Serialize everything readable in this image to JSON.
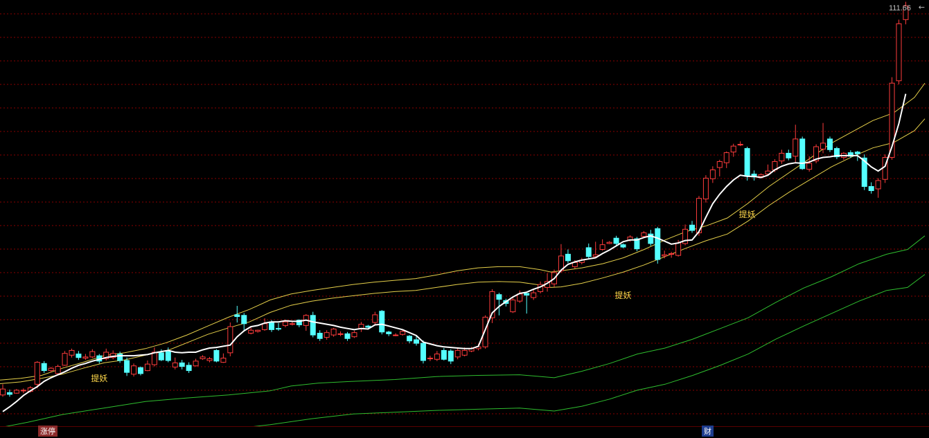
{
  "header": {
    "max_price": "111.66",
    "max_arrow": "←"
  },
  "signals": [
    {
      "label": "提妖"
    },
    {
      "label": "提妖"
    },
    {
      "label": "提妖"
    }
  ],
  "footer": {
    "tag1": "涨停",
    "tag2": "财"
  },
  "colors": {
    "background": "#000000",
    "grid": "#8b0000",
    "up": "#ff3c3c",
    "down": "#54ffff",
    "ma": "#ffffff",
    "band": "#e6d04a",
    "green_band": "#2fbf2f",
    "signal": "#ffd84a"
  },
  "chart_data": {
    "type": "candlestick",
    "ylim": [
      40,
      112
    ],
    "grid": true,
    "max_label": 111.66,
    "candles": [
      [
        45.5,
        46.5,
        45.2,
        47.3
      ],
      [
        45.9,
        45.6,
        45.2,
        46.4
      ],
      [
        45.8,
        46.3,
        45.7,
        46.5
      ],
      [
        46.2,
        46.3,
        45.8,
        46.6
      ],
      [
        46.1,
        46.7,
        45.9,
        47.0
      ],
      [
        47.3,
        51.0,
        46.6,
        51.2
      ],
      [
        50.8,
        49.6,
        49.2,
        51.2
      ],
      [
        49.6,
        50.0,
        49.3,
        50.2
      ],
      [
        49.1,
        50.3,
        48.9,
        50.6
      ],
      [
        50.5,
        52.5,
        50.4,
        52.9
      ],
      [
        52.2,
        53.0,
        51.8,
        53.3
      ],
      [
        52.4,
        51.8,
        51.4,
        52.9
      ],
      [
        51.7,
        51.9,
        51.4,
        52.4
      ],
      [
        51.9,
        52.8,
        51.7,
        53.2
      ],
      [
        52.1,
        51.2,
        50.8,
        52.4
      ],
      [
        51.6,
        52.7,
        51.3,
        53.3
      ],
      [
        51.8,
        52.5,
        51.5,
        53.0
      ],
      [
        52.4,
        51.3,
        50.9,
        52.8
      ],
      [
        51.3,
        49.3,
        48.7,
        51.8
      ],
      [
        49.0,
        50.4,
        48.6,
        50.8
      ],
      [
        50.1,
        49.1,
        48.8,
        50.3
      ],
      [
        49.6,
        50.7,
        49.5,
        51.3
      ],
      [
        50.6,
        52.7,
        50.3,
        53.5
      ],
      [
        52.6,
        51.4,
        51.2,
        53.2
      ],
      [
        52.8,
        51.3,
        51.0,
        53.5
      ],
      [
        50.2,
        50.9,
        49.8,
        51.8
      ],
      [
        50.9,
        50.3,
        49.8,
        51.4
      ],
      [
        50.5,
        49.6,
        49.2,
        51.0
      ],
      [
        50.4,
        51.2,
        50.3,
        51.6
      ],
      [
        51.6,
        51.9,
        51.4,
        52.2
      ],
      [
        51.3,
        51.6,
        51.0,
        51.9
      ],
      [
        53.0,
        51.2,
        51.0,
        53.2
      ],
      [
        51.0,
        51.7,
        50.9,
        52.5
      ],
      [
        52.6,
        57.0,
        52.0,
        57.7
      ],
      [
        59.0,
        58.7,
        57.7,
        60.5
      ],
      [
        58.9,
        57.5,
        56.4,
        59.3
      ],
      [
        55.9,
        56.4,
        55.7,
        57.0
      ],
      [
        56.2,
        56.4,
        56.0,
        56.5
      ],
      [
        56.5,
        57.5,
        56.3,
        58.4
      ],
      [
        57.8,
        56.5,
        56.1,
        58.1
      ],
      [
        56.7,
        56.6,
        56.3,
        57.6
      ],
      [
        57.2,
        57.8,
        56.9,
        58.1
      ],
      [
        57.5,
        57.5,
        57.2,
        58.0
      ],
      [
        58.1,
        57.3,
        56.9,
        58.2
      ],
      [
        57.2,
        58.9,
        56.3,
        59.1
      ],
      [
        58.9,
        55.6,
        55.2,
        59.5
      ],
      [
        55.9,
        55.0,
        54.6,
        56.4
      ],
      [
        55.2,
        56.0,
        54.8,
        56.4
      ],
      [
        55.6,
        56.6,
        55.3,
        56.8
      ],
      [
        55.7,
        55.8,
        55.4,
        56.2
      ],
      [
        55.8,
        55.0,
        54.6,
        56.1
      ],
      [
        55.3,
        56.0,
        55.1,
        56.3
      ],
      [
        56.6,
        57.4,
        56.1,
        57.8
      ],
      [
        57.1,
        56.9,
        56.7,
        57.3
      ],
      [
        57.7,
        59.0,
        57.3,
        59.5
      ],
      [
        59.6,
        56.1,
        55.7,
        59.8
      ],
      [
        56.1,
        55.8,
        55.4,
        56.3
      ],
      [
        55.6,
        55.6,
        55.4,
        55.9
      ],
      [
        55.7,
        56.2,
        55.5,
        56.6
      ],
      [
        55.4,
        54.6,
        54.2,
        55.6
      ],
      [
        54.8,
        54.2,
        53.8,
        55.6
      ],
      [
        54.2,
        51.3,
        50.8,
        54.7
      ],
      [
        51.7,
        51.7,
        51.2,
        52.1
      ],
      [
        51.5,
        52.4,
        51.2,
        52.9
      ],
      [
        53.0,
        51.5,
        51.3,
        53.4
      ],
      [
        52.9,
        51.2,
        50.7,
        53.2
      ],
      [
        51.9,
        53.0,
        51.5,
        53.3
      ],
      [
        52.2,
        53.0,
        52.0,
        53.5
      ],
      [
        52.9,
        53.3,
        52.7,
        53.6
      ],
      [
        53.3,
        53.6,
        53.0,
        54.1
      ],
      [
        53.6,
        58.6,
        53.3,
        58.9
      ],
      [
        58.5,
        62.9,
        57.6,
        63.3
      ],
      [
        62.4,
        61.6,
        58.9,
        62.7
      ],
      [
        61.4,
        60.9,
        60.4,
        61.7
      ],
      [
        59.5,
        61.5,
        59.3,
        62.0
      ],
      [
        61.3,
        62.5,
        61.0,
        63.1
      ],
      [
        62.6,
        62.3,
        59.2,
        62.6
      ],
      [
        61.9,
        62.7,
        61.5,
        63.2
      ],
      [
        62.9,
        64.1,
        62.6,
        64.6
      ],
      [
        63.6,
        64.6,
        62.9,
        66.0
      ],
      [
        64.2,
        66.1,
        63.7,
        66.6
      ],
      [
        66.4,
        68.9,
        66.1,
        70.9
      ],
      [
        69.2,
        68.1,
        67.7,
        70.0
      ],
      [
        67.1,
        67.8,
        66.8,
        68.2
      ],
      [
        67.8,
        68.2,
        67.5,
        68.6
      ],
      [
        70.3,
        68.8,
        68.5,
        71.0
      ],
      [
        68.8,
        69.1,
        68.6,
        71.3
      ],
      [
        70.0,
        70.8,
        69.8,
        71.7
      ],
      [
        71.0,
        71.2,
        70.9,
        71.4
      ],
      [
        71.9,
        71.0,
        70.6,
        72.3
      ],
      [
        70.8,
        70.4,
        70.2,
        71.0
      ],
      [
        71.6,
        72.1,
        71.3,
        72.4
      ],
      [
        71.8,
        70.1,
        69.7,
        72.1
      ],
      [
        72.2,
        72.8,
        71.9,
        73.1
      ],
      [
        72.6,
        71.0,
        70.6,
        73.3
      ],
      [
        73.5,
        68.3,
        67.6,
        73.8
      ],
      [
        68.9,
        69.1,
        68.5,
        69.8
      ],
      [
        69.2,
        69.3,
        68.6,
        69.6
      ],
      [
        69.0,
        71.1,
        68.8,
        71.6
      ],
      [
        71.0,
        73.4,
        70.7,
        74.2
      ],
      [
        74.1,
        73.2,
        72.8,
        74.8
      ],
      [
        72.8,
        78.6,
        72.3,
        79.0
      ],
      [
        78.5,
        82.0,
        77.9,
        82.5
      ],
      [
        81.9,
        83.4,
        81.2,
        84.0
      ],
      [
        83.8,
        84.8,
        82.3,
        85.1
      ],
      [
        84.6,
        86.3,
        83.7,
        86.5
      ],
      [
        86.4,
        87.4,
        85.6,
        87.8
      ],
      [
        87.7,
        87.7,
        87.4,
        88.2
      ],
      [
        87.0,
        82.3,
        81.6,
        87.3
      ],
      [
        82.7,
        82.2,
        81.6,
        83.3
      ],
      [
        82.3,
        82.6,
        82.0,
        82.8
      ],
      [
        82.7,
        83.2,
        82.6,
        84.3
      ],
      [
        83.4,
        84.8,
        83.0,
        85.2
      ],
      [
        84.9,
        86.2,
        84.4,
        86.8
      ],
      [
        86.2,
        85.4,
        85.0,
        86.8
      ],
      [
        85.7,
        88.6,
        84.7,
        91.0
      ],
      [
        88.6,
        83.6,
        83.4,
        89.0
      ],
      [
        83.5,
        84.5,
        83.1,
        85.7
      ],
      [
        84.9,
        87.3,
        84.5,
        87.7
      ],
      [
        86.9,
        87.9,
        86.2,
        91.3
      ],
      [
        88.6,
        86.8,
        86.4,
        89.0
      ],
      [
        87.0,
        85.6,
        85.2,
        87.3
      ],
      [
        85.5,
        86.2,
        85.1,
        86.4
      ],
      [
        86.3,
        85.7,
        85.4,
        86.7
      ],
      [
        86.4,
        86.1,
        84.9,
        86.6
      ],
      [
        85.4,
        80.6,
        80.0,
        86.0
      ],
      [
        80.6,
        79.9,
        79.4,
        81.3
      ],
      [
        80.2,
        81.6,
        78.7,
        82.0
      ],
      [
        81.8,
        85.5,
        81.2,
        86.0
      ],
      [
        85.5,
        98.0,
        85.1,
        99.0
      ],
      [
        98.4,
        108.0,
        97.8,
        108.7
      ],
      [
        108.7,
        111.0,
        107.9,
        111.7
      ]
    ],
    "ma": [
      42.7,
      43.5,
      44.4,
      45.4,
      46.2,
      46.9,
      47.8,
      48.4,
      48.9,
      49.4,
      50.0,
      50.5,
      50.8,
      51.2,
      51.5,
      51.8,
      52.0,
      52.1,
      52.1,
      52.1,
      52.2,
      52.3,
      52.6,
      52.8,
      53.0,
      52.7,
      52.6,
      52.7,
      52.7,
      53.1,
      53.4,
      53.5,
      53.7,
      53.9,
      55.3,
      56.3,
      57.0,
      57.2,
      57.6,
      57.8,
      57.8,
      58.0,
      57.9,
      57.9,
      58.1,
      57.8,
      57.6,
      57.4,
      57.2,
      56.9,
      56.7,
      56.5,
      56.7,
      56.6,
      57.3,
      57.4,
      57.1,
      56.8,
      56.5,
      56.0,
      55.5,
      54.4,
      54.1,
      53.8,
      53.6,
      53.5,
      53.4,
      53.3,
      53.3,
      53.7,
      56.5,
      59.3,
      60.4,
      61.2,
      62.0,
      62.6,
      62.8,
      63.3,
      63.7,
      64.3,
      65.1,
      66.5,
      67.5,
      67.9,
      68.2,
      68.4,
      68.6,
      69.3,
      69.9,
      70.6,
      71.3,
      71.6,
      71.6,
      72.0,
      72.3,
      71.9,
      71.4,
      70.9,
      71.1,
      71.5,
      71.6,
      73.0,
      75.4,
      77.7,
      79.3,
      80.6,
      81.7,
      82.5,
      82.3,
      82.3,
      82.1,
      82.5,
      83.4,
      84.0,
      84.4,
      84.6,
      84.5,
      84.7,
      85.2,
      85.5,
      85.6,
      85.8,
      85.8,
      85.8,
      85.8,
      84.9,
      83.9,
      83.2,
      84.0,
      87.3,
      91.2,
      96.2
    ],
    "band_upper": [
      [
        0,
        48.0
      ],
      [
        30,
        48.3
      ],
      [
        60,
        48.8
      ],
      [
        90,
        50.0
      ],
      [
        120,
        51.0
      ],
      [
        150,
        52.1
      ],
      [
        180,
        52.6
      ],
      [
        210,
        53.3
      ],
      [
        240,
        54.3
      ],
      [
        270,
        55.6
      ],
      [
        300,
        57.1
      ],
      [
        330,
        58.6
      ],
      [
        360,
        59.9
      ],
      [
        390,
        61.5
      ],
      [
        420,
        62.5
      ],
      [
        450,
        63.1
      ],
      [
        480,
        63.6
      ],
      [
        510,
        64.1
      ],
      [
        540,
        64.5
      ],
      [
        570,
        64.8
      ],
      [
        600,
        65.1
      ],
      [
        630,
        65.7
      ],
      [
        660,
        66.4
      ],
      [
        690,
        66.9
      ],
      [
        720,
        67.1
      ],
      [
        750,
        67.1
      ],
      [
        780,
        66.6
      ],
      [
        795,
        66.2
      ],
      [
        810,
        66.4
      ],
      [
        840,
        66.9
      ],
      [
        870,
        67.6
      ],
      [
        900,
        68.6
      ],
      [
        930,
        70.0
      ],
      [
        960,
        71.6
      ],
      [
        990,
        73.0
      ],
      [
        1020,
        74.0
      ],
      [
        1050,
        75.3
      ],
      [
        1080,
        77.8
      ],
      [
        1110,
        80.6
      ],
      [
        1140,
        83.0
      ],
      [
        1170,
        85.4
      ],
      [
        1200,
        87.9
      ],
      [
        1230,
        89.8
      ],
      [
        1260,
        91.7
      ],
      [
        1290,
        93.0
      ],
      [
        1320,
        95.6
      ],
      [
        1335,
        98.0
      ]
    ],
    "band_lower": [
      [
        0,
        47.4
      ],
      [
        30,
        47.7
      ],
      [
        60,
        48.3
      ],
      [
        90,
        49.0
      ],
      [
        120,
        50.0
      ],
      [
        150,
        50.9
      ],
      [
        180,
        51.4
      ],
      [
        210,
        52.2
      ],
      [
        240,
        52.9
      ],
      [
        270,
        54.3
      ],
      [
        300,
        55.7
      ],
      [
        330,
        56.8
      ],
      [
        360,
        57.8
      ],
      [
        390,
        59.4
      ],
      [
        420,
        60.6
      ],
      [
        450,
        61.3
      ],
      [
        480,
        61.8
      ],
      [
        510,
        62.2
      ],
      [
        540,
        62.6
      ],
      [
        570,
        62.9
      ],
      [
        600,
        63.1
      ],
      [
        630,
        63.6
      ],
      [
        660,
        64.1
      ],
      [
        690,
        64.5
      ],
      [
        720,
        64.6
      ],
      [
        750,
        64.5
      ],
      [
        780,
        64.0
      ],
      [
        795,
        63.6
      ],
      [
        810,
        63.7
      ],
      [
        840,
        64.3
      ],
      [
        870,
        65.2
      ],
      [
        900,
        66.2
      ],
      [
        930,
        67.4
      ],
      [
        960,
        68.8
      ],
      [
        990,
        70.2
      ],
      [
        1020,
        71.5
      ],
      [
        1050,
        72.6
      ],
      [
        1080,
        74.8
      ],
      [
        1110,
        77.4
      ],
      [
        1140,
        79.7
      ],
      [
        1170,
        81.8
      ],
      [
        1200,
        83.9
      ],
      [
        1230,
        85.6
      ],
      [
        1260,
        87.1
      ],
      [
        1290,
        88.0
      ],
      [
        1320,
        90.0
      ],
      [
        1335,
        92.0
      ]
    ],
    "green_upper": [
      [
        0,
        40.0
      ],
      [
        40,
        40.9
      ],
      [
        90,
        42.2
      ],
      [
        150,
        43.3
      ],
      [
        210,
        44.4
      ],
      [
        270,
        45.0
      ],
      [
        330,
        45.5
      ],
      [
        390,
        46.2
      ],
      [
        420,
        47.0
      ],
      [
        460,
        47.5
      ],
      [
        510,
        47.8
      ],
      [
        570,
        48.1
      ],
      [
        630,
        48.6
      ],
      [
        690,
        48.8
      ],
      [
        750,
        48.9
      ],
      [
        800,
        48.4
      ],
      [
        840,
        49.5
      ],
      [
        880,
        50.8
      ],
      [
        920,
        52.4
      ],
      [
        960,
        53.4
      ],
      [
        1000,
        54.9
      ],
      [
        1040,
        56.7
      ],
      [
        1080,
        58.5
      ],
      [
        1120,
        61.1
      ],
      [
        1160,
        63.5
      ],
      [
        1200,
        65.4
      ],
      [
        1240,
        67.6
      ],
      [
        1280,
        69.2
      ],
      [
        1310,
        70.0
      ],
      [
        1335,
        72.3
      ]
    ],
    "green_lower": [
      [
        0,
        35.3
      ],
      [
        40,
        35.6
      ],
      [
        90,
        36.0
      ],
      [
        150,
        37.0
      ],
      [
        210,
        38.3
      ],
      [
        270,
        39.0
      ],
      [
        330,
        39.7
      ],
      [
        390,
        40.5
      ],
      [
        450,
        41.5
      ],
      [
        510,
        42.3
      ],
      [
        570,
        42.6
      ],
      [
        630,
        42.9
      ],
      [
        690,
        43.1
      ],
      [
        750,
        43.3
      ],
      [
        800,
        42.8
      ],
      [
        840,
        43.6
      ],
      [
        880,
        44.8
      ],
      [
        920,
        46.3
      ],
      [
        960,
        47.3
      ],
      [
        1000,
        48.8
      ],
      [
        1040,
        50.5
      ],
      [
        1080,
        52.4
      ],
      [
        1120,
        54.9
      ],
      [
        1160,
        57.1
      ],
      [
        1200,
        59.2
      ],
      [
        1240,
        61.3
      ],
      [
        1280,
        63.1
      ],
      [
        1310,
        63.6
      ],
      [
        1335,
        65.8
      ]
    ],
    "signals": [
      {
        "index": 13,
        "price": 48.4
      },
      {
        "index": 89,
        "price": 62.4
      },
      {
        "index": 107,
        "price": 76.0
      }
    ]
  }
}
